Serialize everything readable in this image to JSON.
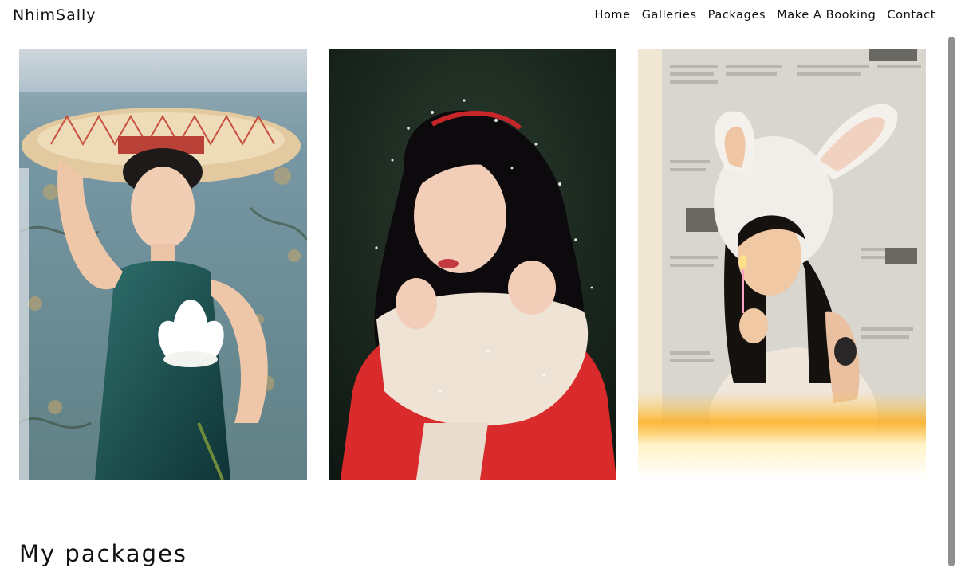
{
  "header": {
    "brand": "NhimSally",
    "nav": [
      {
        "label": "Home"
      },
      {
        "label": "Galleries"
      },
      {
        "label": "Packages"
      },
      {
        "label": "Make A Booking"
      },
      {
        "label": "Contact"
      }
    ]
  },
  "gallery": {
    "photos": [
      {
        "subject": "woman in conical hat holding white lotus"
      },
      {
        "subject": "woman in red sweater with cream scarf in falling snow"
      },
      {
        "subject": "woman in white bunny hood holding a candle before newspapers"
      }
    ]
  },
  "main": {
    "section_title": "My packages"
  },
  "colors": {
    "text": "#111111",
    "background": "#ffffff",
    "scrollbar_thumb": "#8f8f8f"
  }
}
